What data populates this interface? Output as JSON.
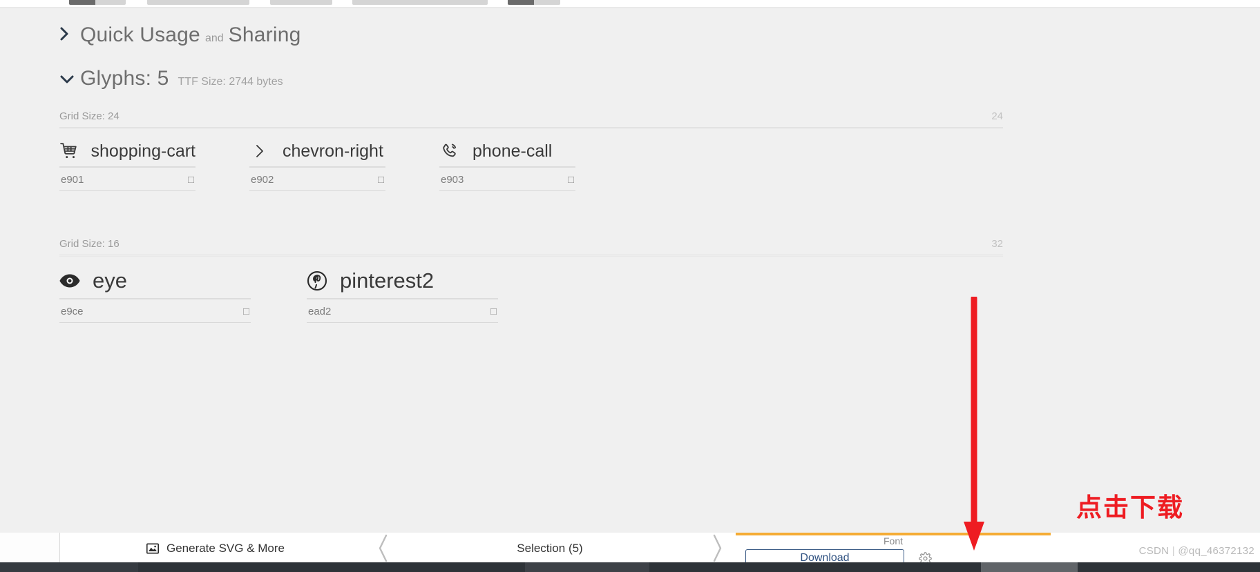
{
  "sections": {
    "quick_usage": {
      "title": "Quick Usage",
      "conjunction": "and",
      "title2": "Sharing",
      "caret": "chevron-right-icon"
    },
    "glyphs": {
      "title": "Glyphs: 5",
      "subtitle": "TTF Size: 2744 bytes",
      "caret": "chevron-down-icon"
    }
  },
  "grid_groups": [
    {
      "label": "Grid Size: 24",
      "right_value": "24",
      "glyphs": [
        {
          "icon": "shopping-cart-icon",
          "name": "shopping-cart",
          "code": "e901",
          "preview": "□"
        },
        {
          "icon": "chevron-right-icon",
          "name": "chevron-right",
          "code": "e902",
          "preview": "□"
        },
        {
          "icon": "phone-call-icon",
          "name": "phone-call",
          "code": "e903",
          "preview": "□"
        }
      ]
    },
    {
      "label": "Grid Size: 16",
      "right_value": "32",
      "glyphs": [
        {
          "icon": "eye-icon",
          "name": "eye",
          "code": "e9ce",
          "preview": "□"
        },
        {
          "icon": "pinterest-icon",
          "name": "pinterest2",
          "code": "ead2",
          "preview": "□"
        }
      ]
    }
  ],
  "toolbar": {
    "generate_label": "Generate SVG & More",
    "generate_icon": "image-icon",
    "selection_label": "Selection (5)",
    "font_label": "Font",
    "download_label": "Download",
    "settings_icon": "gear-icon",
    "accent_color": "#f5ac35",
    "download_border_color": "#3b5b86"
  },
  "annotations": {
    "callout_text": "点击下载",
    "callout_color": "#ee1c22",
    "arrow": "down-arrow-annotation"
  },
  "watermark": {
    "brand": "CSDN",
    "user": "@qq_46372132"
  }
}
